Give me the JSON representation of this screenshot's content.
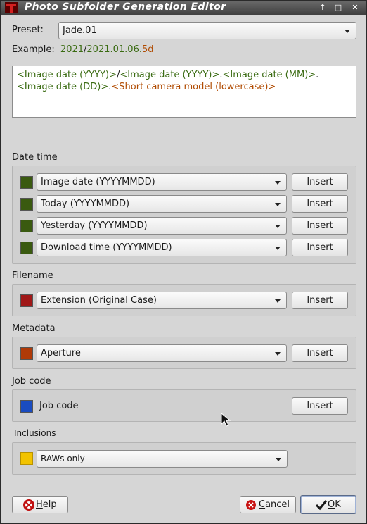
{
  "window": {
    "title": "Photo Subfolder Generation Editor"
  },
  "preset": {
    "label": "Preset:",
    "value": "Jade.01"
  },
  "example": {
    "label": "Example:",
    "part1": "2021",
    "sep1": "/",
    "part2": "2021.01.06.",
    "part3": "5d",
    "colors": {
      "date": "#3a6b12",
      "camera": "#b04a00",
      "sep": "#1a1a1a"
    }
  },
  "format": {
    "t1": "<Image date (YYYY)>",
    "t2": "/",
    "t3": "<Image date (YYYY)>",
    "t4": ".",
    "t5": "<Image date (MM)>",
    "t6": ".",
    "t7": "<Image date (DD)>",
    "t8": ".",
    "t9": "<Short camera model (lowercase)>"
  },
  "sections": {
    "datetime": {
      "title": "Date time",
      "color": "#3a5a10",
      "rows": [
        {
          "value": "Image date (YYYYMMDD)",
          "button": "Insert"
        },
        {
          "value": "Today (YYYYMMDD)",
          "button": "Insert"
        },
        {
          "value": "Yesterday (YYYYMMDD)",
          "button": "Insert"
        },
        {
          "value": "Download time (YYYYMMDD)",
          "button": "Insert"
        }
      ]
    },
    "filename": {
      "title": "Filename",
      "color": "#a01818",
      "rows": [
        {
          "value": "Extension (Original Case)",
          "button": "Insert"
        }
      ]
    },
    "metadata": {
      "title": "Metadata",
      "color": "#b03a08",
      "rows": [
        {
          "value": "Aperture",
          "button": "Insert"
        }
      ]
    },
    "jobcode": {
      "title": "Job code",
      "color": "#1a4cc0",
      "label": "Job code",
      "button": "Insert"
    },
    "inclusions": {
      "title": "Inclusions",
      "color": "#f2c300",
      "value": "RAWs only"
    }
  },
  "footer": {
    "help_prefix": "",
    "help_mnemonic": "H",
    "help_rest": "elp",
    "cancel_mnemonic": "C",
    "cancel_rest": "ancel",
    "ok_mnemonic": "O",
    "ok_rest": "K"
  }
}
